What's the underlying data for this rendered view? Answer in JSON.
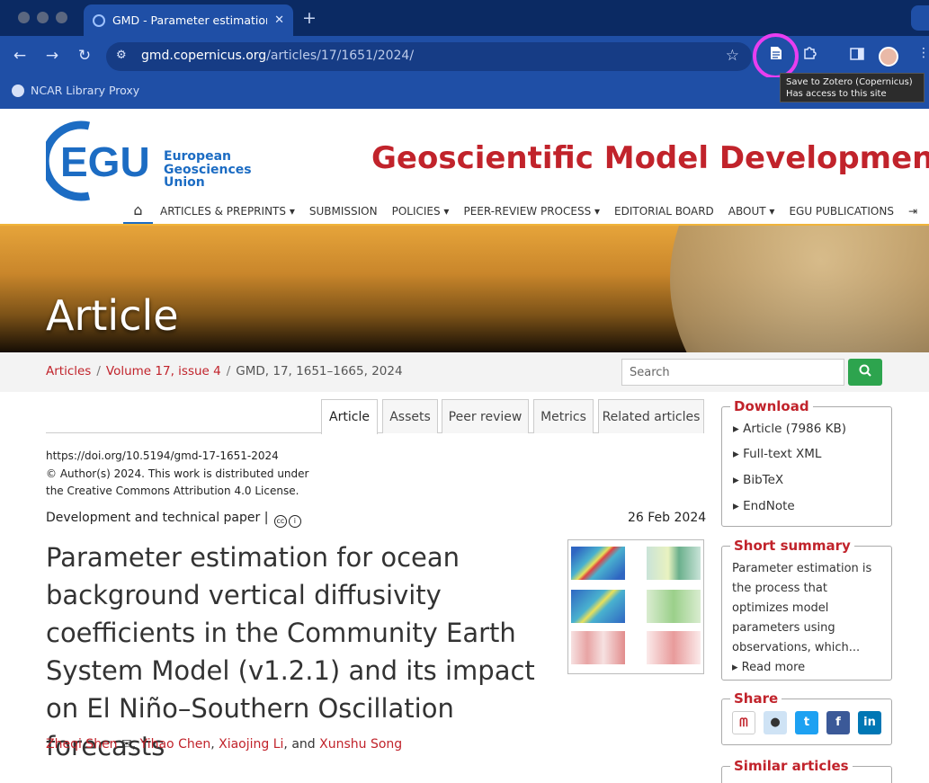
{
  "browser": {
    "tab_title": "GMD - Parameter estimation f",
    "tab_close": "✕",
    "new_tab": "+",
    "url_host": "gmd.copernicus.org",
    "url_path": "/articles/17/1651/2024/",
    "bookmark": "NCAR Library Proxy",
    "tooltip_line1": "Save to Zotero (Copernicus)",
    "tooltip_line2": "Has access to this site"
  },
  "header": {
    "logo_letters": "EGU",
    "logo_line1": "European",
    "logo_line2": "Geosciences",
    "logo_line3": "Union",
    "journal_title": "Geoscientific Model Development",
    "nav": [
      "ARTICLES & PREPRINTS",
      "SUBMISSION",
      "POLICIES",
      "PEER-REVIEW PROCESS",
      "EDITORIAL BOARD",
      "ABOUT",
      "EGU PUBLICATIONS"
    ]
  },
  "banner": {
    "title": "Article"
  },
  "breadcrumb": {
    "articles": "Articles",
    "volume": "Volume 17, issue 4",
    "current": "GMD, 17, 1651–1665, 2024"
  },
  "search": {
    "placeholder": "Search"
  },
  "tabs": [
    "Article",
    "Assets",
    "Peer review",
    "Metrics",
    "Related articles"
  ],
  "meta": {
    "doi": "https://doi.org/10.5194/gmd-17-1651-2024",
    "copyright": "© Author(s) 2024. This work is distributed under",
    "license": "the Creative Commons Attribution 4.0 License."
  },
  "article": {
    "type": "Development and technical paper",
    "date": "26 Feb 2024",
    "title": "Parameter estimation for ocean background vertical diffusivity coefficients in the Community Earth System Model (v1.2.1) and its impact on El Niño–Southern Oscillation forecasts",
    "authors": [
      "Zheqi Shen",
      "Yihao Chen",
      "Xiaojing Li",
      "Xunshu Song"
    ],
    "and": "and"
  },
  "download": {
    "title": "Download",
    "article": "Article",
    "article_size": "(7986 KB)",
    "xml": "Full-text XML",
    "bibtex": "BibTeX",
    "endnote": "EndNote"
  },
  "summary": {
    "title": "Short summary",
    "text": "Parameter estimation is the process that optimizes model parameters using observations, which...",
    "read_more": "Read more"
  },
  "share": {
    "title": "Share"
  },
  "similar": {
    "title": "Similar articles"
  },
  "colors": {
    "brand_red": "#c1232b",
    "brand_blue": "#1c6cc3",
    "browser_blue": "#1f4fa6",
    "search_green": "#2da44e",
    "highlight_magenta": "#e83ef0"
  }
}
